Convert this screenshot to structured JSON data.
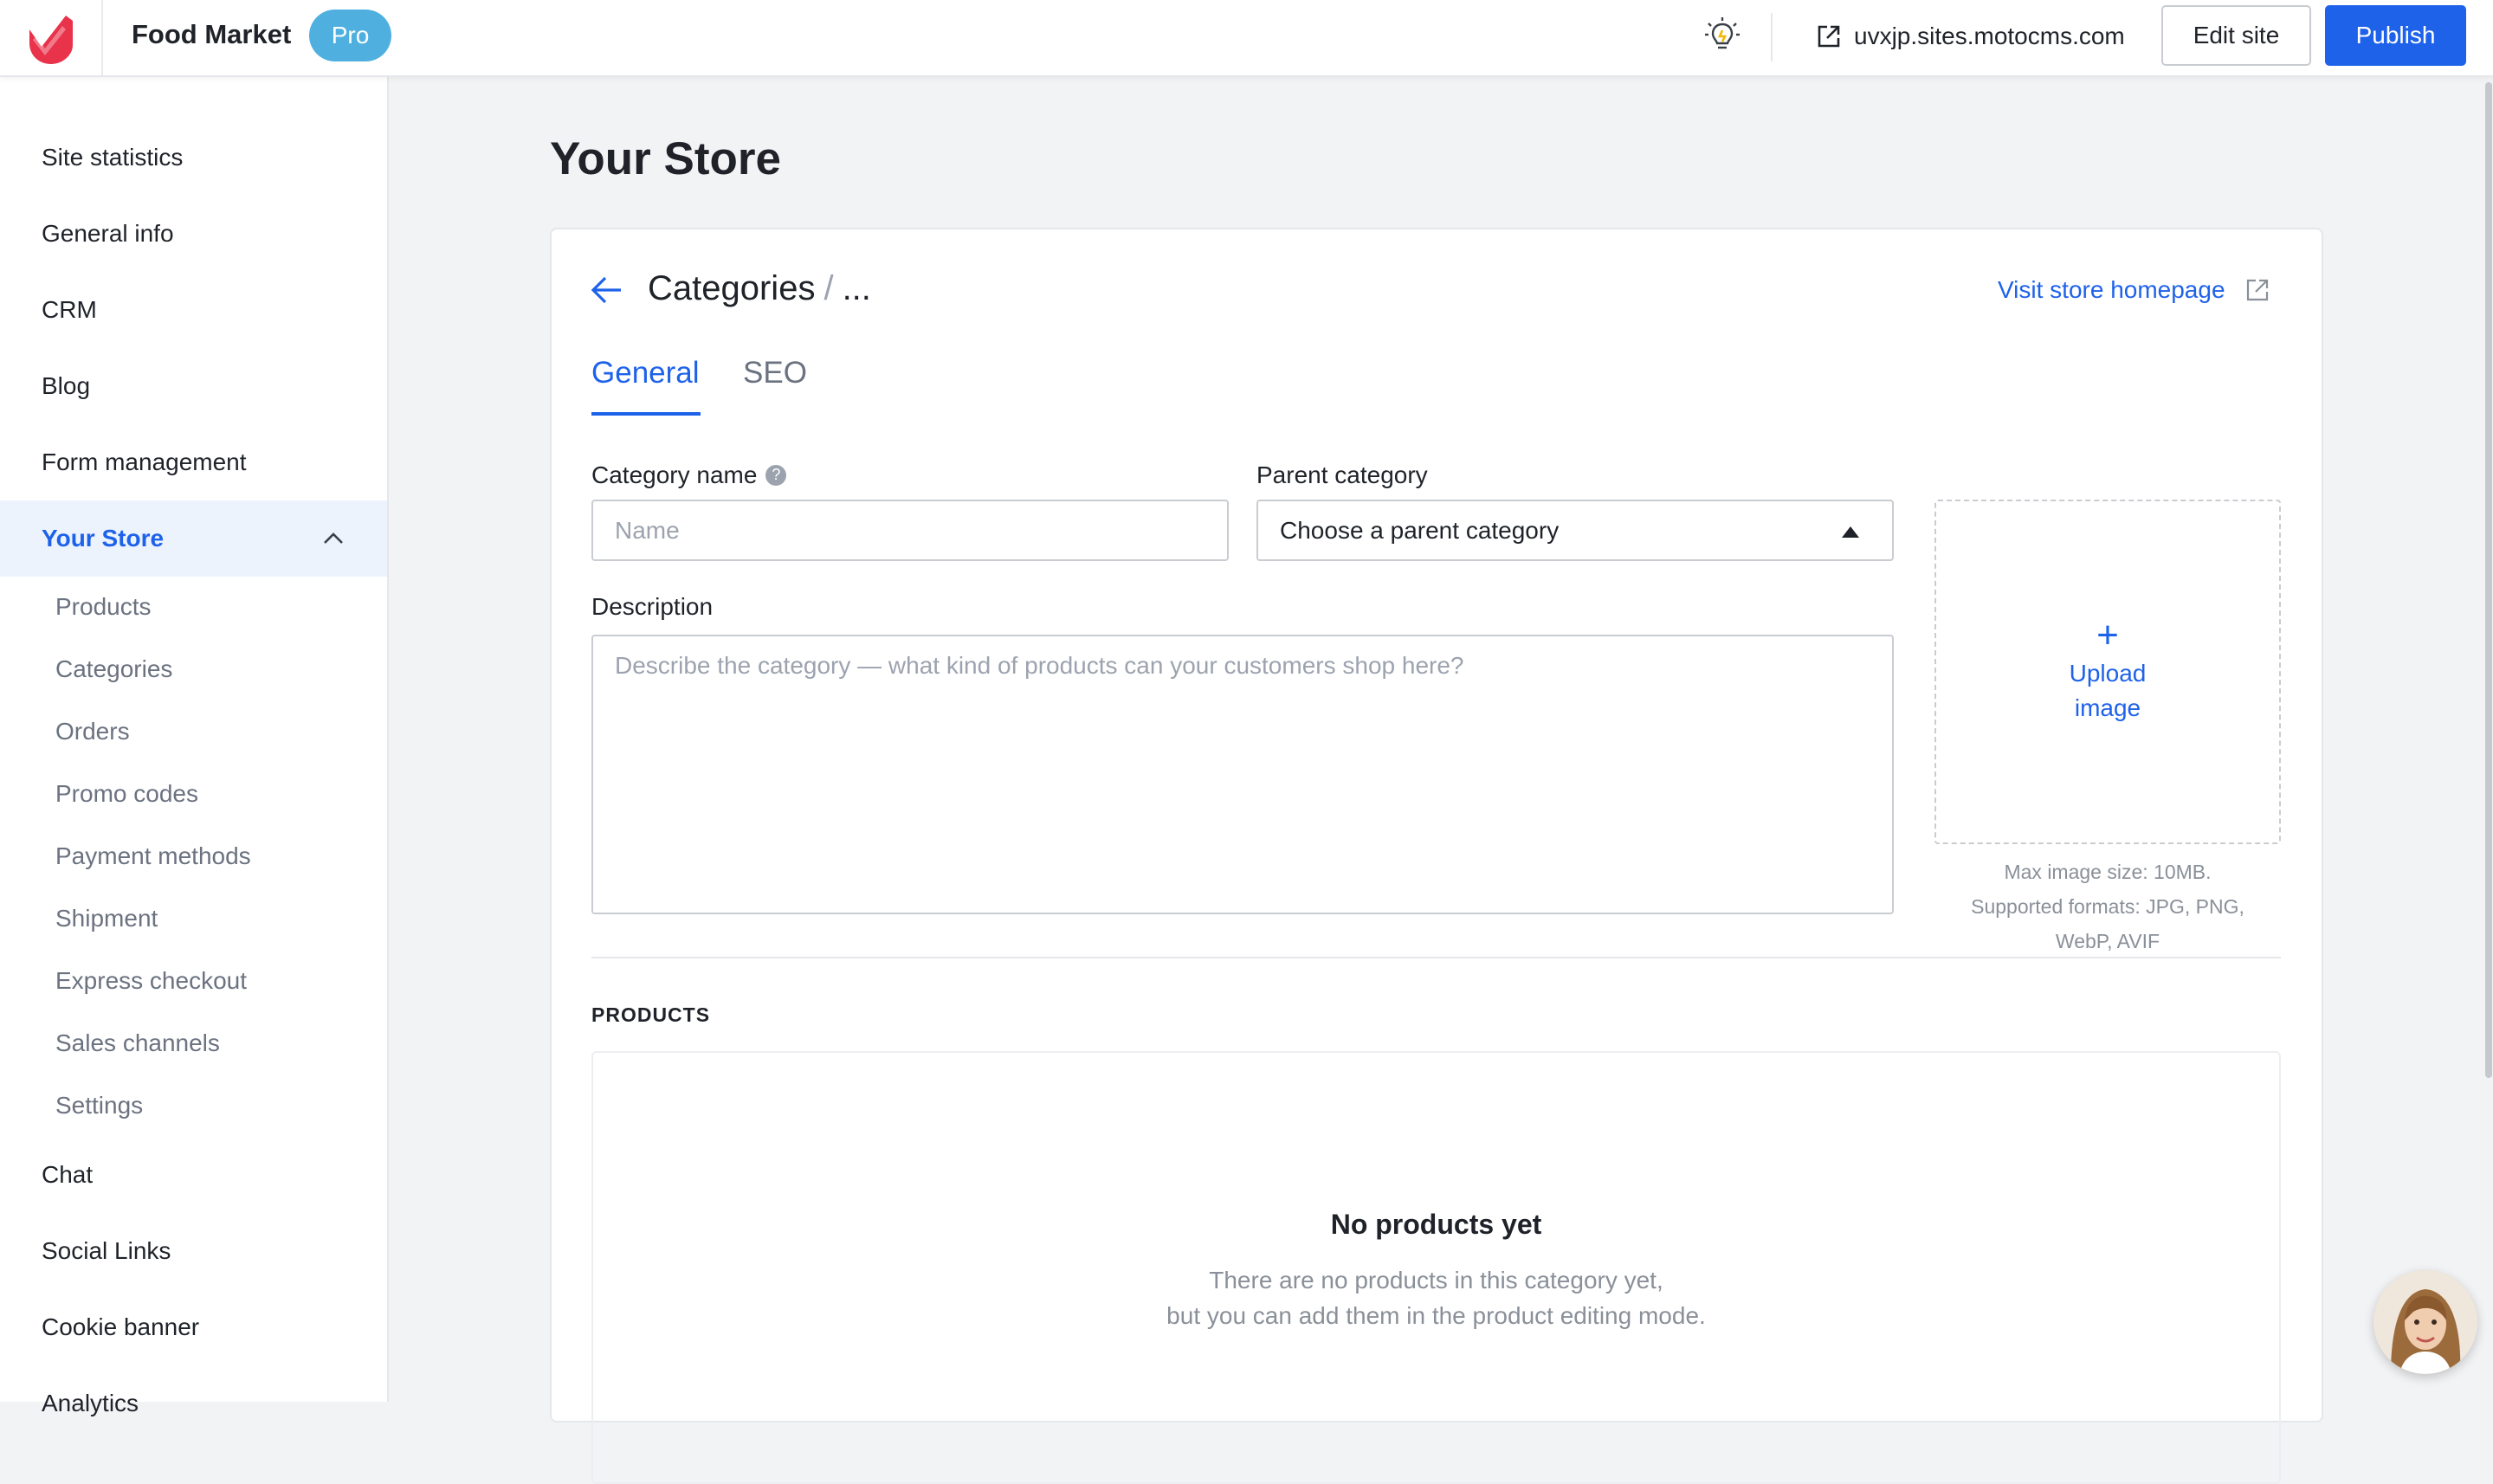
{
  "header": {
    "site_name": "Food Market",
    "plan_badge": "Pro",
    "domain": "uvxjp.sites.motocms.com",
    "edit_label": "Edit site",
    "publish_label": "Publish",
    "accent": "#1e62ea",
    "badge_color": "#4fb0e0",
    "logo_color": "#e8334a"
  },
  "sidebar": {
    "items": [
      {
        "label": "Site statistics"
      },
      {
        "label": "General info"
      },
      {
        "label": "CRM"
      },
      {
        "label": "Blog"
      },
      {
        "label": "Form management"
      },
      {
        "label": "Your Store",
        "active": true,
        "expanded": true
      },
      {
        "label": "Chat"
      },
      {
        "label": "Social Links"
      },
      {
        "label": "Cookie banner"
      },
      {
        "label": "Analytics"
      }
    ],
    "store_subitems": [
      "Products",
      "Categories",
      "Orders",
      "Promo codes",
      "Payment methods",
      "Shipment",
      "Express checkout",
      "Sales channels",
      "Settings"
    ]
  },
  "main": {
    "page_title": "Your Store",
    "breadcrumb": {
      "section": "Categories",
      "separator": "/",
      "current": "..."
    },
    "visit_link": "Visit store homepage",
    "tabs": [
      {
        "label": "General",
        "active": true
      },
      {
        "label": "SEO",
        "active": false
      }
    ],
    "form": {
      "category_name_label": "Category name",
      "category_name_placeholder": "Name",
      "help_glyph": "?",
      "parent_label": "Parent category",
      "parent_value": "Choose a parent category",
      "description_label": "Description",
      "description_placeholder": "Describe the category — what kind of products can your customers shop here?"
    },
    "upload": {
      "plus": "+",
      "line1": "Upload",
      "line2": "image",
      "note1": "Max image size: 10MB.",
      "note2": "Supported formats: JPG, PNG,",
      "note3": "WebP, AVIF"
    },
    "products": {
      "heading": "PRODUCTS",
      "empty_title": "No products yet",
      "empty_line1": "There are no products in this category yet,",
      "empty_line2": "but you can add them in the product editing mode."
    }
  }
}
